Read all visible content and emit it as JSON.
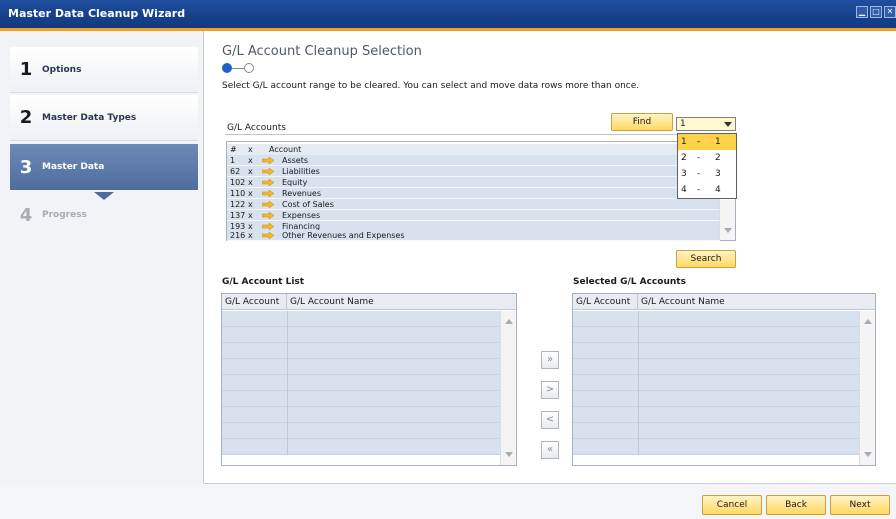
{
  "window": {
    "title": "Master Data Cleanup Wizard",
    "controls": [
      "minimize-icon",
      "maximize-icon",
      "close-icon"
    ]
  },
  "sidebar": {
    "steps": [
      {
        "num": "1",
        "label": "Options"
      },
      {
        "num": "2",
        "label": "Master Data Types"
      },
      {
        "num": "3",
        "label": "Master Data"
      },
      {
        "num": "4",
        "label": "Progress"
      }
    ]
  },
  "main": {
    "heading": "G/L Account Cleanup Selection",
    "instruction": "Select G/L account range to be cleared. You can select and move data rows more than once.",
    "gl_accounts_label": "G/L Accounts",
    "find_label": "Find",
    "search_label": "Search",
    "dropdown": {
      "selected": "1",
      "options": [
        {
          "from": "1",
          "sep": "-",
          "to": "1"
        },
        {
          "from": "2",
          "sep": "-",
          "to": "2"
        },
        {
          "from": "3",
          "sep": "-",
          "to": "3"
        },
        {
          "from": "4",
          "sep": "-",
          "to": "4"
        }
      ]
    },
    "accounts_table": {
      "headers": {
        "num": "#",
        "x": "x",
        "account": "Account"
      },
      "rows": [
        {
          "num": "1",
          "x": "x",
          "account": "Assets"
        },
        {
          "num": "62",
          "x": "x",
          "account": "Liabilities"
        },
        {
          "num": "102",
          "x": "x",
          "account": "Equity"
        },
        {
          "num": "110",
          "x": "x",
          "account": "Revenues"
        },
        {
          "num": "122",
          "x": "x",
          "account": "Cost of Sales"
        },
        {
          "num": "137",
          "x": "x",
          "account": "Expenses"
        },
        {
          "num": "193",
          "x": "x",
          "account": "Financing"
        },
        {
          "num": "216",
          "x": "x",
          "account": "Other Revenues and Expenses"
        }
      ]
    },
    "account_list": {
      "title": "G/L Account List",
      "col1": "G/L Account",
      "col2": "G/L Account Name"
    },
    "selected_accounts": {
      "title": "Selected G/L Accounts",
      "col1": "G/L Account",
      "col2": "G/L Account Name"
    },
    "move_buttons": [
      "»",
      ">",
      "<",
      "«"
    ]
  },
  "footer": {
    "cancel": "Cancel",
    "back": "Back",
    "next": "Next"
  },
  "colors": {
    "titlebar": "#16408a",
    "accent": "#f0a020",
    "row_fill": "#d8e2ee",
    "selected_option": "#ffd24a"
  }
}
